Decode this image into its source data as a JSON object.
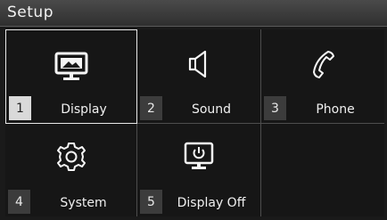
{
  "header": {
    "title": "Setup"
  },
  "tiles": [
    {
      "number": "1",
      "label": "Display",
      "icon": "display-icon",
      "selected": true
    },
    {
      "number": "2",
      "label": "Sound",
      "icon": "speaker-icon",
      "selected": false
    },
    {
      "number": "3",
      "label": "Phone",
      "icon": "phone-icon",
      "selected": false
    },
    {
      "number": "4",
      "label": "System",
      "icon": "gear-icon",
      "selected": false
    },
    {
      "number": "5",
      "label": "Display Off",
      "icon": "display-off-icon",
      "selected": false
    }
  ],
  "colors": {
    "background": "#1a1a1a",
    "border": "#4d4d4d",
    "selected_border": "#e8e8e8",
    "text": "#f0f0f0"
  }
}
